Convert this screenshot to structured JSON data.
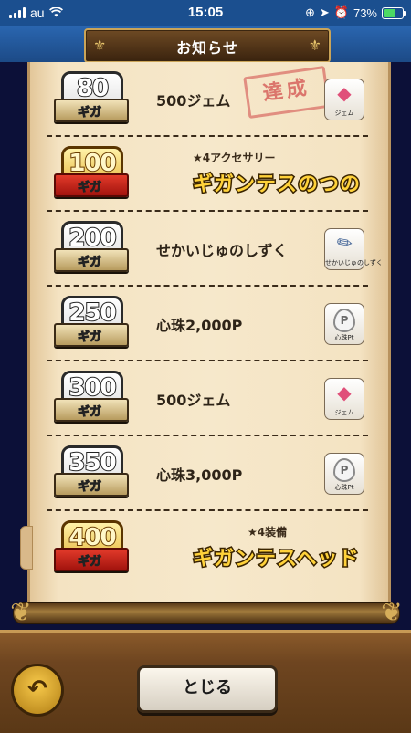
{
  "statusbar": {
    "carrier": "au",
    "time": "15:05",
    "battery": "73%",
    "battery_level": 0.73
  },
  "header": {
    "title": "お知らせ"
  },
  "rows": [
    {
      "value": "80",
      "unit": "ギガ",
      "label": "500ジェム",
      "icon": "gem-icon",
      "icon_caption": "ジェム",
      "stamp": "達成"
    },
    {
      "value": "100",
      "unit": "ギガ",
      "featured": true,
      "sub": "★4アクセサリー",
      "title": "ギガンテスのつの"
    },
    {
      "value": "200",
      "unit": "ギガ",
      "label": "せかいじゅのしずく",
      "icon": "drop-icon",
      "icon_caption": "せかいじゅのしずく"
    },
    {
      "value": "250",
      "unit": "ギガ",
      "label": "心珠2,000P",
      "icon": "pt-icon",
      "icon_caption": "心珠Pt",
      "icon_letter": "P"
    },
    {
      "value": "300",
      "unit": "ギガ",
      "label": "500ジェム",
      "icon": "gem-icon",
      "icon_caption": "ジェム"
    },
    {
      "value": "350",
      "unit": "ギガ",
      "label": "心珠3,000P",
      "icon": "pt-icon",
      "icon_caption": "心珠Pt",
      "icon_letter": "P"
    },
    {
      "value": "400",
      "unit": "ギガ",
      "featured": true,
      "sub": "★4装備",
      "title": "ギガンテスヘッド"
    }
  ],
  "footer": {
    "close_label": "とじる"
  }
}
